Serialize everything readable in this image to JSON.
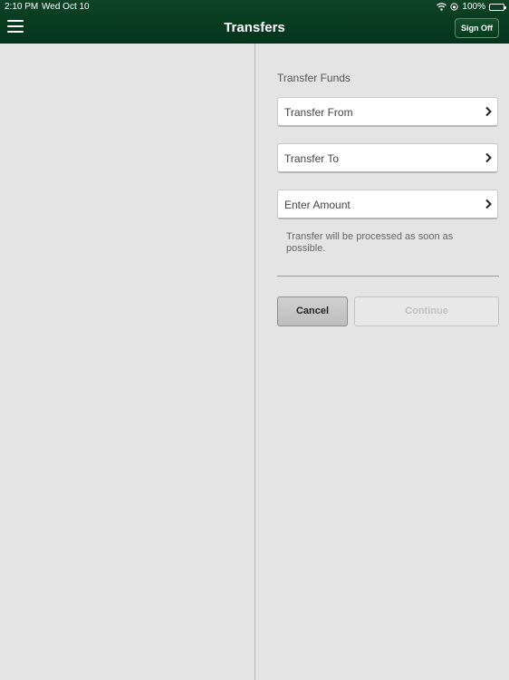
{
  "status_bar": {
    "time": "2:10 PM",
    "date": "Wed Oct 10",
    "battery": "100%",
    "battery_level": 1.0
  },
  "nav": {
    "title": "Transfers",
    "signoff_label": "Sign Off"
  },
  "form": {
    "section_title": "Transfer Funds",
    "rows": [
      {
        "label": "Transfer From"
      },
      {
        "label": "Transfer To"
      },
      {
        "label": "Enter Amount"
      }
    ],
    "note": "Transfer will be processed as soon as possible.",
    "cancel_label": "Cancel",
    "continue_label": "Continue"
  },
  "colors": {
    "header": "#02351b",
    "background": "#e4e4e4"
  }
}
